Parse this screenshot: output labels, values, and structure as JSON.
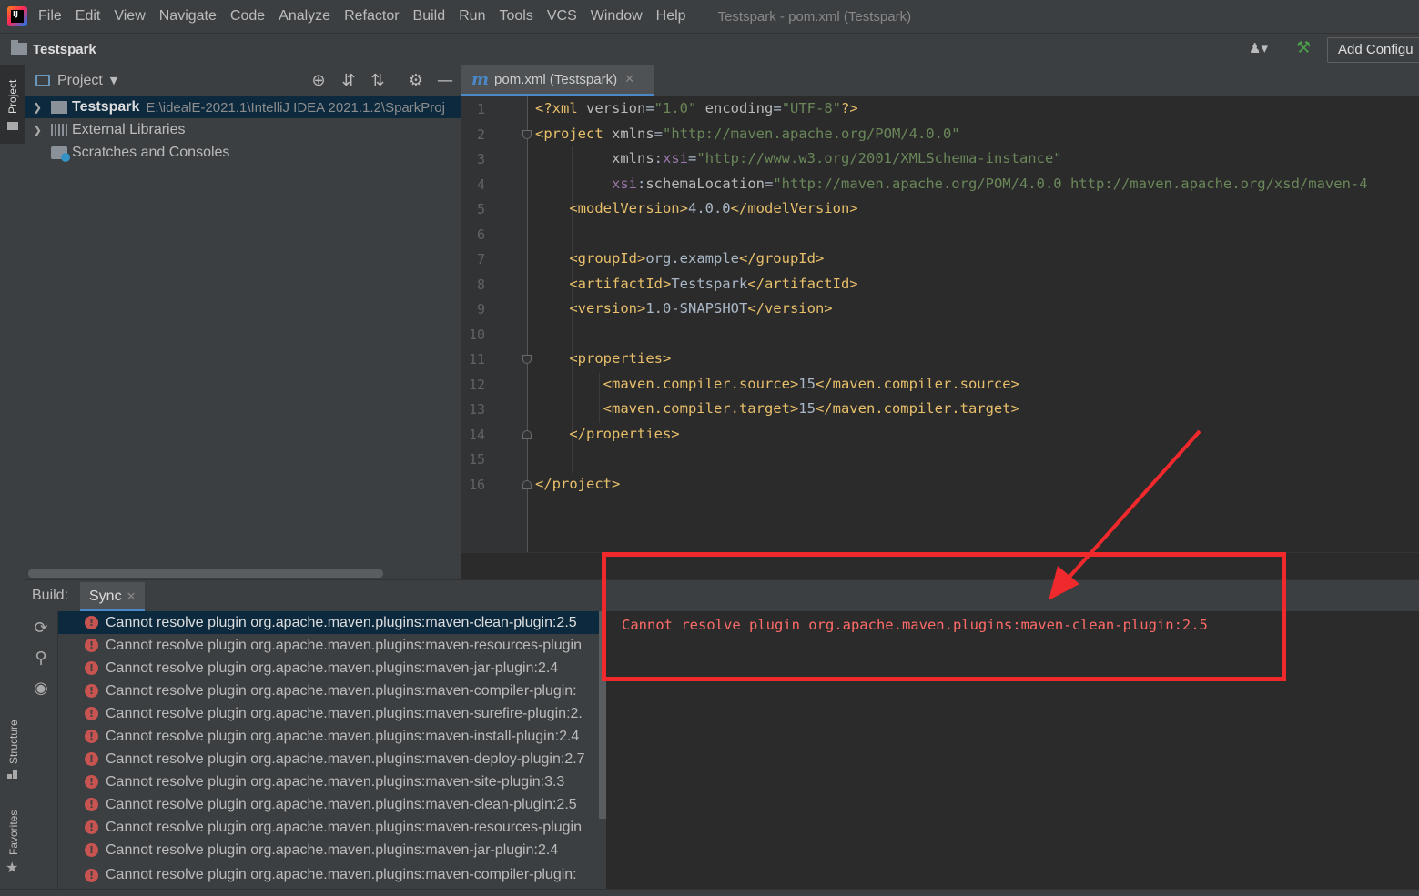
{
  "menubar": {
    "items": [
      "File",
      "Edit",
      "View",
      "Navigate",
      "Code",
      "Analyze",
      "Refactor",
      "Build",
      "Run",
      "Tools",
      "VCS",
      "Window",
      "Help"
    ],
    "window_title": "Testspark - pom.xml (Testspark)"
  },
  "navbar": {
    "project": "Testspark",
    "add_config": "Add Configu"
  },
  "side_tabs": {
    "project": "Project",
    "structure": "Structure",
    "favorites": "Favorites"
  },
  "project_panel": {
    "title": "Project",
    "tree": [
      {
        "label": "Testspark",
        "path": "E:\\idealE-2021.1\\IntelliJ IDEA 2021.1.2\\SparkProj"
      },
      {
        "label": "External Libraries"
      },
      {
        "label": "Scratches and Consoles"
      }
    ]
  },
  "editor": {
    "tab_label": "pom.xml (Testspark)",
    "line_numbers": [
      "1",
      "2",
      "3",
      "4",
      "5",
      "6",
      "7",
      "8",
      "9",
      "10",
      "11",
      "12",
      "13",
      "14",
      "15",
      "16"
    ],
    "xml": {
      "decl_open": "<?xml ",
      "version_attr": "version",
      "version_val": "\"1.0\"",
      "encoding_attr": " encoding",
      "encoding_val": "\"UTF-8\"",
      "decl_close": "?>",
      "project_open": "<project ",
      "xmlns_attr": "xmlns",
      "xmlns_val": "\"http://maven.apache.org/POM/4.0.0\"",
      "xmlns_prefix": "xmlns",
      "xsi": "xsi",
      "xsi_ns_val": "\"http://www.w3.org/2001/XMLSchema-instance\"",
      "schema_attr": "schemaLocation",
      "schema_val": "\"http://maven.apache.org/POM/4.0.0 http://maven.apache.org/xsd/maven-4",
      "tag_close": ">",
      "model_open": "<modelVersion>",
      "model_val": "4.0.0",
      "model_close": "</modelVersion>",
      "group_open": "<groupId>",
      "group_val": "org.example",
      "group_close": "</groupId>",
      "artifact_open": "<artifactId>",
      "artifact_val": "Testspark",
      "artifact_close": "</artifactId>",
      "version_open": "<version>",
      "version_text": "1.0-SNAPSHOT",
      "version_close": "</version>",
      "props_open": "<properties>",
      "src_open": "<maven.compiler.source>",
      "src_val": "15",
      "src_close": "</maven.compiler.source>",
      "tgt_open": "<maven.compiler.target>",
      "tgt_val": "15",
      "tgt_close": "</maven.compiler.target>",
      "props_close": "</properties>",
      "project_close": "</project>"
    }
  },
  "build": {
    "label": "Build:",
    "tab": "Sync",
    "items": [
      "Cannot resolve plugin org.apache.maven.plugins:maven-clean-plugin:2.5",
      "Cannot resolve plugin org.apache.maven.plugins:maven-resources-plugin",
      "Cannot resolve plugin org.apache.maven.plugins:maven-jar-plugin:2.4",
      "Cannot resolve plugin org.apache.maven.plugins:maven-compiler-plugin:",
      "Cannot resolve plugin org.apache.maven.plugins:maven-surefire-plugin:2.",
      "Cannot resolve plugin org.apache.maven.plugins:maven-install-plugin:2.4",
      "Cannot resolve plugin org.apache.maven.plugins:maven-deploy-plugin:2.7",
      "Cannot resolve plugin org.apache.maven.plugins:maven-site-plugin:3.3",
      "Cannot resolve plugin org.apache.maven.plugins:maven-clean-plugin:2.5",
      "Cannot resolve plugin org.apache.maven.plugins:maven-resources-plugin",
      "Cannot resolve plugin org.apache.maven.plugins:maven-jar-plugin:2.4",
      "Cannot resolve plugin org.apache.maven.plugins:maven-compiler-plugin:"
    ],
    "detail": "Cannot resolve plugin org.apache.maven.plugins:maven-clean-plugin:2.5"
  },
  "colors": {
    "error": "#ff6b68",
    "annotation": "#f0292c",
    "accent": "#4a88c7"
  }
}
